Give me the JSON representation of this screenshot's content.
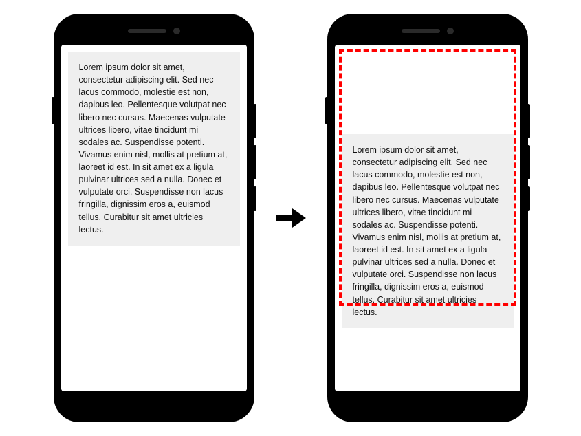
{
  "lorem": "Lorem ipsum dolor sit amet, consectetur adipiscing elit. Sed nec lacus commodo, molestie est non, dapibus leo. Pellentesque volutpat nec libero nec cursus. Maecenas vulputate ultrices libero, vitae tincidunt mi sodales ac. Suspendisse potenti. Vivamus enim nisl, mollis at pretium at, laoreet id est. In sit amet ex a ligula pulvinar ultrices sed a nulla. Donec et vulputate orci. Suspendisse non lacus fringilla, dignissim eros a, euismod tellus. Curabitur sit amet ultricies lectus."
}
